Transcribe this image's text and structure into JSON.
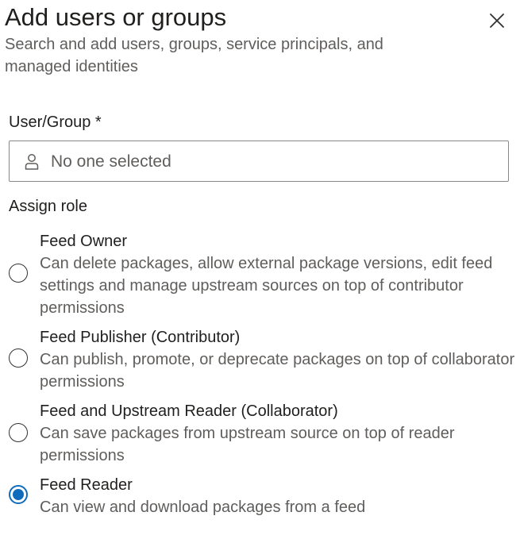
{
  "panel": {
    "title": "Add users or groups",
    "subtitle": "Search and add users, groups, service principals, and managed identities",
    "close_icon": "close-icon"
  },
  "user_group": {
    "label": "User/Group *",
    "placeholder": "No one selected",
    "icon": "person-icon"
  },
  "assign_role": {
    "label": "Assign role",
    "selected": "Feed Reader",
    "options": [
      {
        "name": "Feed Owner",
        "description": "Can delete packages, allow external package versions, edit feed settings and manage upstream sources on top of contributor permissions"
      },
      {
        "name": "Feed Publisher (Contributor)",
        "description": "Can publish, promote, or deprecate packages on top of collaborator permissions"
      },
      {
        "name": "Feed and Upstream Reader (Collaborator)",
        "description": "Can save packages from upstream source on top of reader permissions"
      },
      {
        "name": "Feed Reader",
        "description": "Can view and download packages from a feed"
      }
    ]
  },
  "colors": {
    "accent": "#0f6cbd",
    "text_primary": "#201f1e",
    "text_secondary": "#605e5c",
    "border": "#8a8886"
  }
}
